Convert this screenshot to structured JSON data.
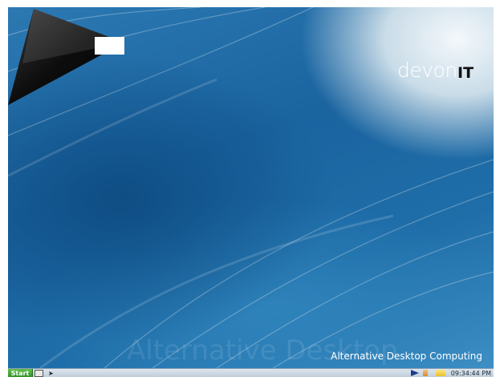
{
  "desktop": {
    "brand": {
      "name": "devon",
      "suffix": "IT"
    },
    "watermark_text": "Alternative Desktop",
    "tagline": "Alternative Desktop Computing"
  },
  "taskbar": {
    "start_label": "Start",
    "quick_launch": [
      {
        "icon": "terminal-icon"
      },
      {
        "icon": "cursor-arrow-icon"
      }
    ],
    "tray": [
      {
        "icon": "play-arrow-icon"
      },
      {
        "icon": "network-icon"
      },
      {
        "icon": "folder-icon"
      }
    ],
    "clock": "09:34:44 PM"
  },
  "colors": {
    "wallpaper_blue": "#1a64a0",
    "start_green": "#3f9f34",
    "logo_dark": "#141414"
  }
}
